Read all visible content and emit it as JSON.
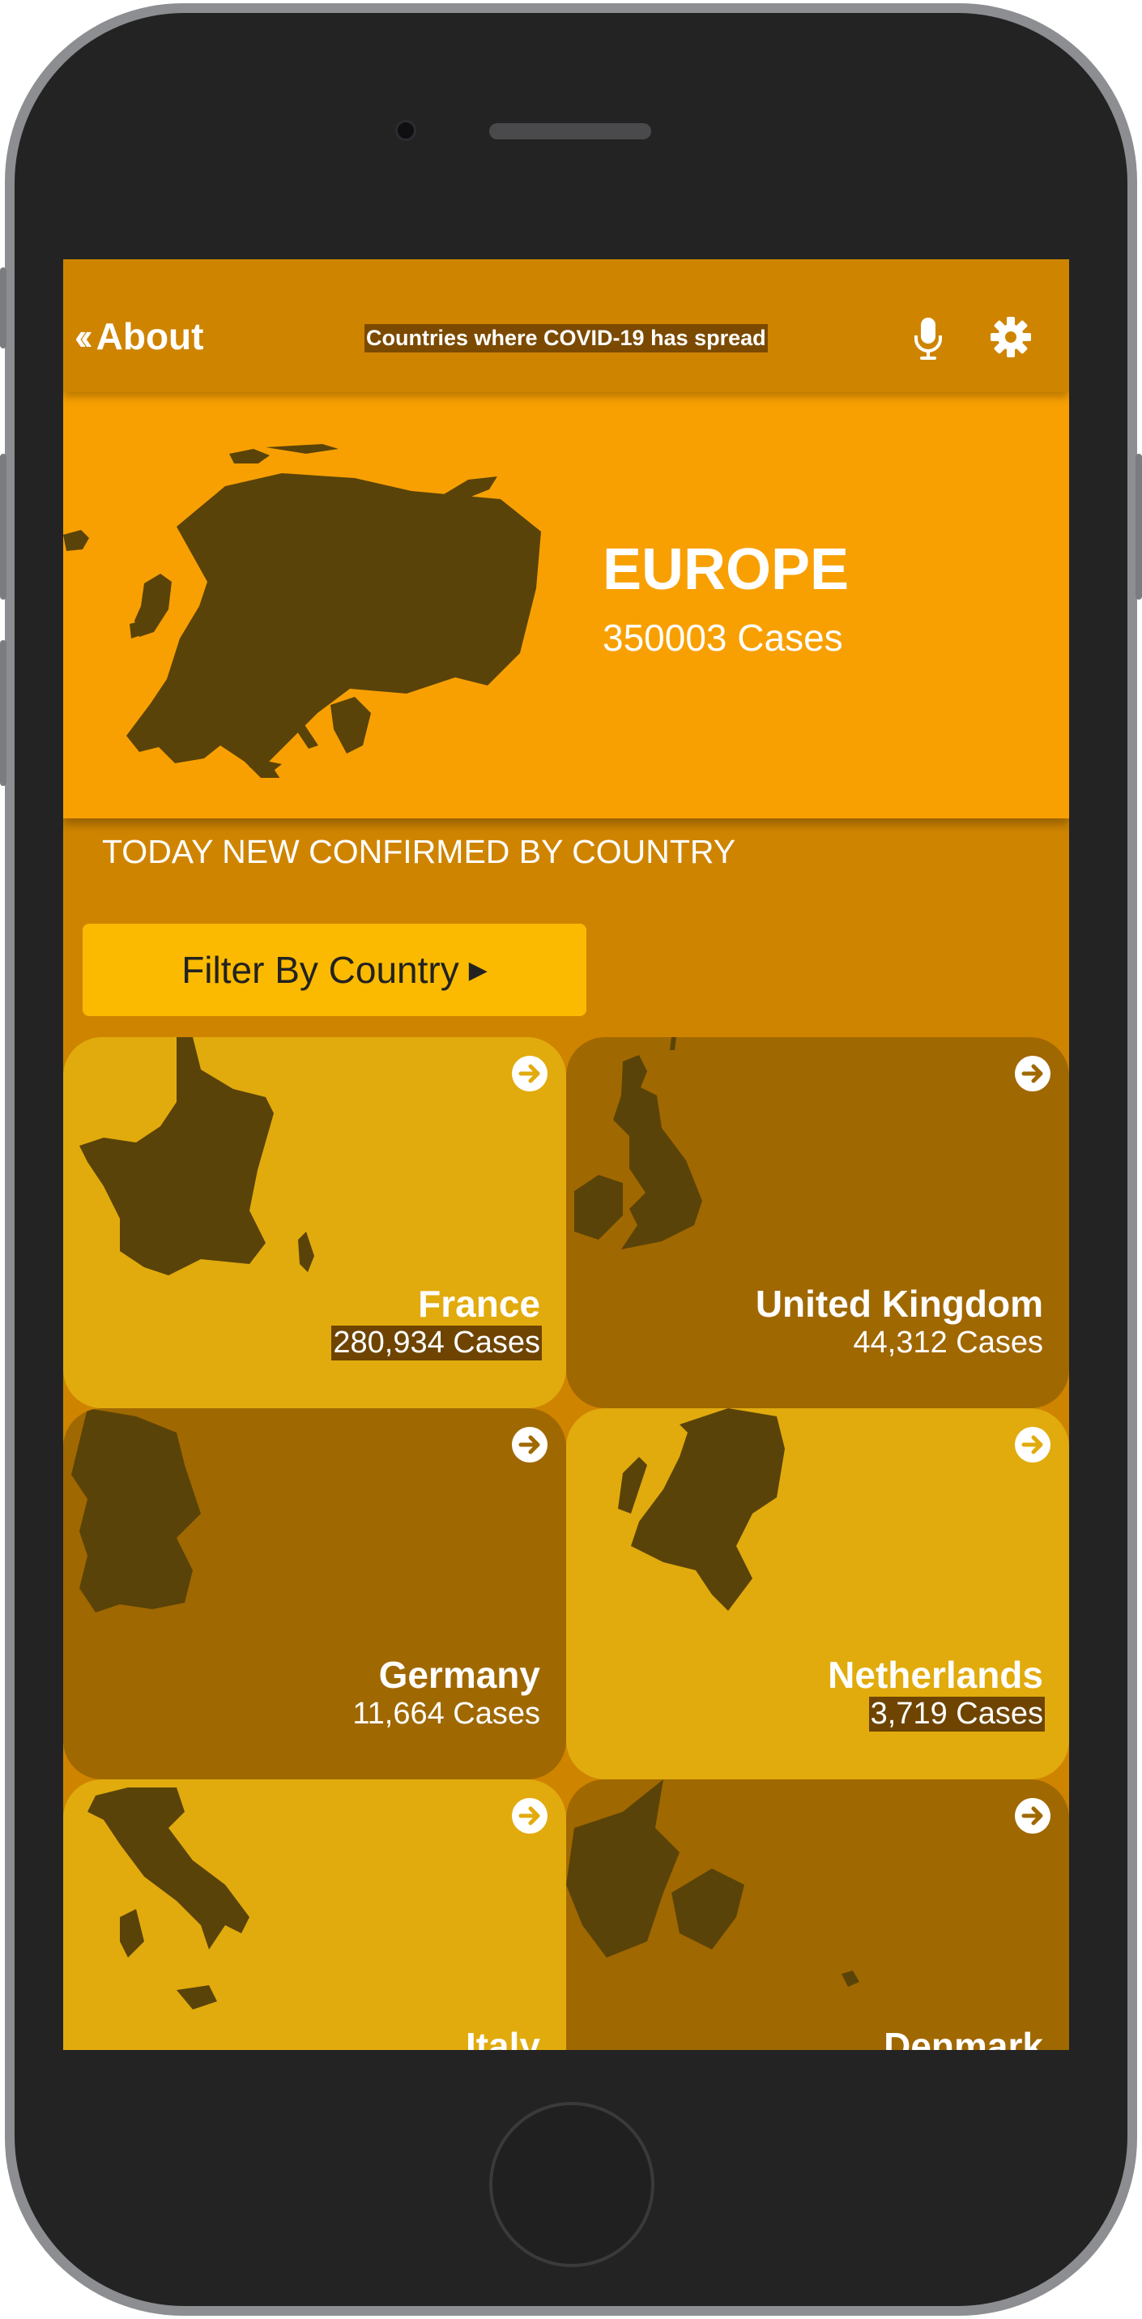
{
  "header": {
    "back_label": "About",
    "title": "Countries where COVID-19 has spread",
    "mic_icon": "microphone-icon",
    "settings_icon": "gear-icon"
  },
  "region": {
    "name": "EUROPE",
    "cases": "350003 Cases"
  },
  "section_title": "TODAY NEW CONFIRMED BY COUNTRY",
  "filter_button": "Filter By Country",
  "countries": [
    {
      "name": "France",
      "cases": "280,934 Cases"
    },
    {
      "name": "United Kingdom",
      "cases": "44,312 Cases"
    },
    {
      "name": "Germany",
      "cases": "11,664 Cases"
    },
    {
      "name": "Netherlands",
      "cases": "3,719 Cases"
    },
    {
      "name": "Italy",
      "cases": ""
    },
    {
      "name": "Denmark",
      "cases": ""
    }
  ],
  "colors": {
    "topbar": "#cf8400",
    "hero": "#f8a002",
    "card_light": "#e1ab0d",
    "card_dark": "#a06800",
    "map": "#5a4308",
    "filter_button": "#fbba00"
  }
}
